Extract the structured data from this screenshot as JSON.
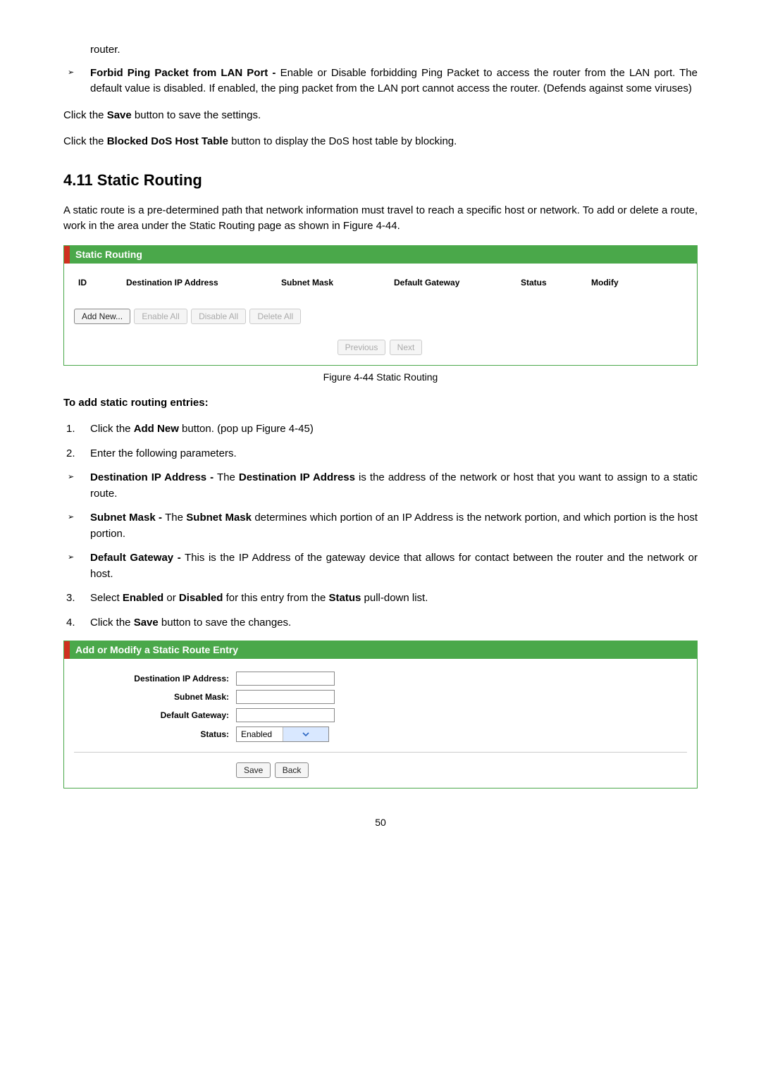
{
  "intro": {
    "router_trailer": "router.",
    "forbid_label": "Forbid Ping Packet from LAN Port -",
    "forbid_text": " Enable or Disable forbidding Ping Packet to access the router from the LAN port. The default value is disabled. If enabled, the ping packet from the LAN port cannot access the router. (Defends against some viruses)",
    "save_line_a": "Click the ",
    "save_bold": "Save",
    "save_line_b": " button to save the settings.",
    "blocked_line_a": "Click the ",
    "blocked_bold": "Blocked DoS Host Table",
    "blocked_line_b": " button to display the DoS host table by blocking."
  },
  "section": {
    "heading": "4.11  Static Routing",
    "para": "A static route is a pre-determined path that network information must travel to reach a specific host or network. To add or delete a route, work in the area under the Static Routing page as shown in Figure 4-44."
  },
  "routing_panel": {
    "title": "Static Routing",
    "columns": {
      "id": "ID",
      "dest": "Destination IP Address",
      "mask": "Subnet Mask",
      "gw": "Default Gateway",
      "status": "Status",
      "modify": "Modify"
    },
    "buttons": {
      "add": "Add New...",
      "enable": "Enable All",
      "disable": "Disable All",
      "delete": "Delete All",
      "prev": "Previous",
      "next": "Next"
    },
    "caption": "Figure 4-44 Static Routing"
  },
  "how_to": {
    "heading": "To add static routing entries:",
    "step1_a": "Click the ",
    "step1_bold": "Add New",
    "step1_b": " button. (pop up Figure 4-45)",
    "step2": "Enter the following parameters.",
    "dest_label": "Destination IP Address -",
    "dest_text_a": " The ",
    "dest_bold": "Destination IP Address",
    "dest_text_b": " is the address of the network or host that you want to assign to a static route.",
    "mask_label": "Subnet Mask -",
    "mask_text_a": " The ",
    "mask_bold": "Subnet Mask",
    "mask_text_b": " determines which portion of an IP Address is the network portion, and which portion is the host portion.",
    "gw_label": "Default Gateway -",
    "gw_text": " This is the IP Address of the gateway device that allows for contact between the router and the network or host.",
    "step3_a": "Select ",
    "step3_b1": "Enabled",
    "step3_b2": " or ",
    "step3_b3": "Disabled",
    "step3_c": " for this entry from the ",
    "step3_bold": "Status",
    "step3_d": " pull-down list.",
    "step4_a": "Click the ",
    "step4_bold": "Save",
    "step4_b": " button to save the changes."
  },
  "form_panel": {
    "title": "Add or Modify a Static Route Entry",
    "labels": {
      "dest": "Destination IP Address:",
      "mask": "Subnet Mask:",
      "gw": "Default Gateway:",
      "status": "Status:"
    },
    "status_value": "Enabled",
    "buttons": {
      "save": "Save",
      "back": "Back"
    }
  },
  "page_number": "50"
}
